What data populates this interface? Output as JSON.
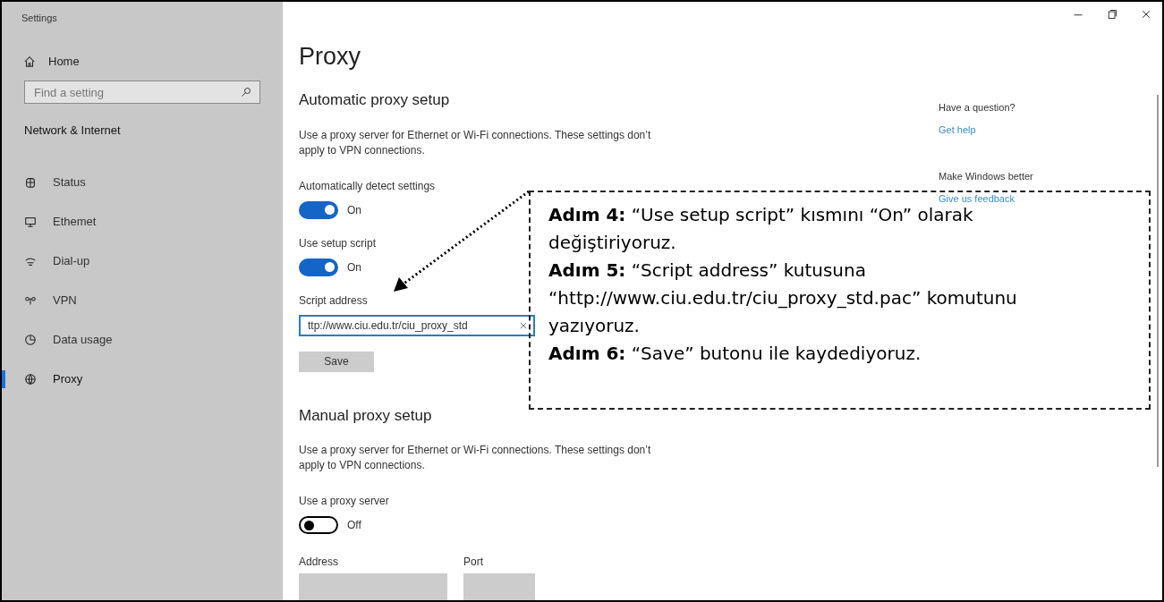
{
  "window": {
    "title": "Settings"
  },
  "sidebar": {
    "home": "Home",
    "search": {
      "placeholder": "Find a setting"
    },
    "section_title": "Network & Internet",
    "items": [
      {
        "label": "Status",
        "selected": false
      },
      {
        "label": "Ethemet",
        "selected": false
      },
      {
        "label": "Dial-up",
        "selected": false
      },
      {
        "label": "VPN",
        "selected": false
      },
      {
        "label": "Data usage",
        "selected": false
      },
      {
        "label": "Proxy",
        "selected": true
      }
    ]
  },
  "main": {
    "title": "Proxy",
    "sections": [
      {
        "heading": "Automatic proxy setup",
        "description": "Use a proxy server for Ethernet or Wi-Fi connections. These settings don’t apply to VPN connections.",
        "settings": [
          {
            "kind": "toggle",
            "label": "Automatically detect settings",
            "on": true,
            "state_text": "On"
          },
          {
            "kind": "toggle",
            "label": "Use setup script",
            "on": true,
            "state_text": "On"
          },
          {
            "kind": "text_field",
            "label": "Script address",
            "value": "ttp://www.ciu.edu.tr/ciu_proxy_std"
          },
          {
            "kind": "button",
            "label": "Save"
          }
        ]
      },
      {
        "heading": "Manual proxy setup",
        "description": "Use a proxy server for Ethernet or Wi-Fi connections. These settings don’t apply to VPN connections.",
        "settings": [
          {
            "kind": "toggle",
            "label": "Use a proxy server",
            "on": false,
            "state_text": "Off"
          },
          {
            "kind": "field_pair",
            "labels": [
              "Address",
              "Port"
            ]
          }
        ]
      }
    ]
  },
  "aside": [
    {
      "heading": "Have a question?",
      "link": "Get help"
    },
    {
      "heading": "Make Windows better",
      "link": "Give us feedback"
    }
  ],
  "annotation": {
    "steps": [
      "**Adım 4:** “Use setup script” kısmını “On” olarak değiştiriyoruz.",
      "**Adım 5:** “Script address” kutusuna “http://www.ciu.edu.tr/ciu_proxy_std.pac” komutunu yazıyoruz.",
      "**Adım 6:** “Save” butonu ile kaydediyoruz."
    ]
  }
}
